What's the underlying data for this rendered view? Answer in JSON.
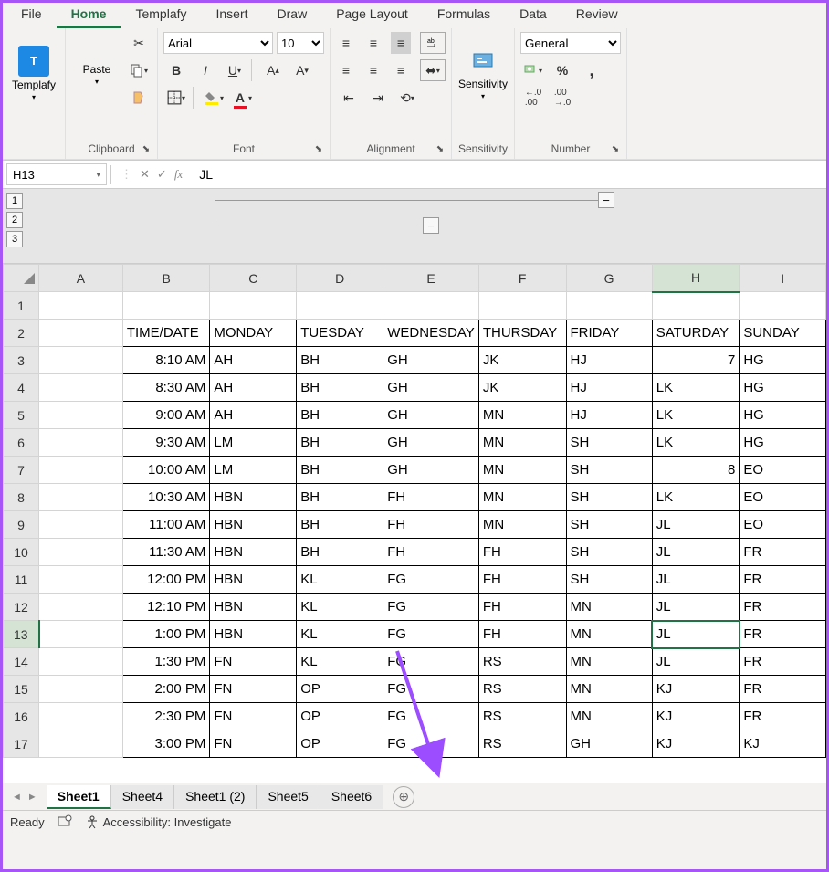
{
  "ribbon_tabs": [
    "File",
    "Home",
    "Templafy",
    "Insert",
    "Draw",
    "Page Layout",
    "Formulas",
    "Data",
    "Review"
  ],
  "active_ribbon_tab": "Home",
  "groups": {
    "templafy": "Templafy",
    "clipboard": "Clipboard",
    "font": "Font",
    "alignment": "Alignment",
    "sensitivity": "Sensitivity",
    "number": "Number"
  },
  "paste_label": "Paste",
  "sensitivity_label": "Sensitivity",
  "font_name": "Arial",
  "font_size": "10",
  "number_format": "General",
  "name_box": "H13",
  "formula_value": "JL",
  "outline_levels": [
    "1",
    "2",
    "3"
  ],
  "columns": [
    "A",
    "B",
    "C",
    "D",
    "E",
    "F",
    "G",
    "H",
    "I"
  ],
  "active_col": "H",
  "active_row": 13,
  "rows": [
    {
      "n": 1,
      "cells": [
        "",
        "",
        "",
        "",
        "",
        "",
        "",
        "",
        ""
      ]
    },
    {
      "n": 2,
      "b": true,
      "cells": [
        "",
        "TIME/DATE",
        "MONDAY",
        "TUESDAY",
        "WEDNESDAY",
        "THURSDAY",
        "FRIDAY",
        "SATURDAY",
        "SUNDAY"
      ]
    },
    {
      "n": 3,
      "b": true,
      "cells": [
        "",
        "8:10 AM",
        "AH",
        "BH",
        "GH",
        "JK",
        "HJ",
        "7",
        "HG"
      ],
      "ra": [
        1,
        7
      ]
    },
    {
      "n": 4,
      "b": true,
      "cells": [
        "",
        "8:30 AM",
        "AH",
        "BH",
        "GH",
        "JK",
        "HJ",
        "LK",
        "HG"
      ],
      "ra": [
        1
      ]
    },
    {
      "n": 5,
      "b": true,
      "cells": [
        "",
        "9:00 AM",
        "AH",
        "BH",
        "GH",
        "MN",
        "HJ",
        "LK",
        "HG"
      ],
      "ra": [
        1
      ]
    },
    {
      "n": 6,
      "b": true,
      "cells": [
        "",
        "9:30 AM",
        "LM",
        "BH",
        "GH",
        "MN",
        "SH",
        "LK",
        "HG"
      ],
      "ra": [
        1
      ]
    },
    {
      "n": 7,
      "b": true,
      "cells": [
        "",
        "10:00 AM",
        "LM",
        "BH",
        "GH",
        "MN",
        "SH",
        "8",
        "EO"
      ],
      "ra": [
        1,
        7
      ]
    },
    {
      "n": 8,
      "b": true,
      "cells": [
        "",
        "10:30 AM",
        "HBN",
        "BH",
        "FH",
        "MN",
        "SH",
        "LK",
        "EO"
      ],
      "ra": [
        1
      ]
    },
    {
      "n": 9,
      "b": true,
      "cells": [
        "",
        "11:00 AM",
        "HBN",
        "BH",
        "FH",
        "MN",
        "SH",
        "JL",
        "EO"
      ],
      "ra": [
        1
      ]
    },
    {
      "n": 10,
      "b": true,
      "cells": [
        "",
        "11:30 AM",
        "HBN",
        "BH",
        "FH",
        "FH",
        "SH",
        "JL",
        "FR"
      ],
      "ra": [
        1
      ]
    },
    {
      "n": 11,
      "b": true,
      "cells": [
        "",
        "12:00 PM",
        "HBN",
        "KL",
        "FG",
        "FH",
        "SH",
        "JL",
        "FR"
      ],
      "ra": [
        1
      ]
    },
    {
      "n": 12,
      "b": true,
      "cells": [
        "",
        "12:10 PM",
        "HBN",
        "KL",
        "FG",
        "FH",
        "MN",
        "JL",
        "FR"
      ],
      "ra": [
        1
      ]
    },
    {
      "n": 13,
      "b": true,
      "cells": [
        "",
        "1:00 PM",
        "HBN",
        "KL",
        "FG",
        "FH",
        "MN",
        "JL",
        "FR"
      ],
      "ra": [
        1
      ]
    },
    {
      "n": 14,
      "b": true,
      "cells": [
        "",
        "1:30 PM",
        "FN",
        "KL",
        "FG",
        "RS",
        "MN",
        "JL",
        "FR"
      ],
      "ra": [
        1
      ]
    },
    {
      "n": 15,
      "b": true,
      "cells": [
        "",
        "2:00 PM",
        "FN",
        "OP",
        "FG",
        "RS",
        "MN",
        "KJ",
        "FR"
      ],
      "ra": [
        1
      ]
    },
    {
      "n": 16,
      "b": true,
      "cells": [
        "",
        "2:30 PM",
        "FN",
        "OP",
        "FG",
        "RS",
        "MN",
        "KJ",
        "FR"
      ],
      "ra": [
        1
      ]
    },
    {
      "n": 17,
      "b": true,
      "cells": [
        "",
        "3:00 PM",
        "FN",
        "OP",
        "FG",
        "RS",
        "GH",
        "KJ",
        "KJ"
      ],
      "ra": [
        1
      ]
    }
  ],
  "sheet_tabs": [
    "Sheet1",
    "Sheet4",
    "Sheet1 (2)",
    "Sheet5",
    "Sheet6"
  ],
  "active_sheet": "Sheet1",
  "status": {
    "ready": "Ready",
    "accessibility": "Accessibility: Investigate"
  }
}
